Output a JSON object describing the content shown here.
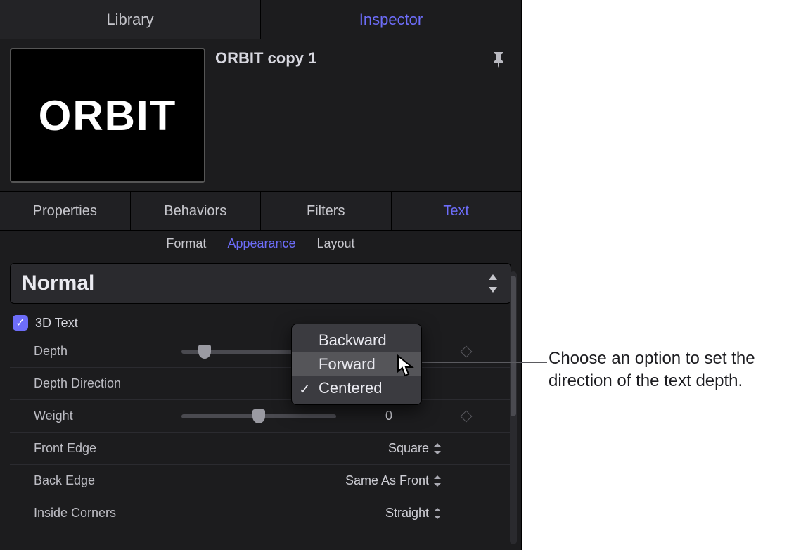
{
  "topTabs": {
    "library": "Library",
    "inspector": "Inspector"
  },
  "project": {
    "thumbText": "ORBIT",
    "title": "ORBIT copy 1"
  },
  "sectionTabs": {
    "properties": "Properties",
    "behaviors": "Behaviors",
    "filters": "Filters",
    "text": "Text"
  },
  "subnav": {
    "format": "Format",
    "appearance": "Appearance",
    "layout": "Layout"
  },
  "styleSelect": "Normal",
  "threeDHeader": "3D Text",
  "rows": {
    "depth": {
      "label": "Depth",
      "value": ""
    },
    "depthDirection": {
      "label": "Depth Direction",
      "value": ""
    },
    "weight": {
      "label": "Weight",
      "value": "0"
    },
    "frontEdge": {
      "label": "Front Edge",
      "value": "Square"
    },
    "backEdge": {
      "label": "Back Edge",
      "value": "Same As Front"
    },
    "insideCorners": {
      "label": "Inside Corners",
      "value": "Straight"
    }
  },
  "menu": {
    "backward": "Backward",
    "forward": "Forward",
    "centered": "Centered"
  },
  "callout": "Choose an option to set the direction of the text depth."
}
